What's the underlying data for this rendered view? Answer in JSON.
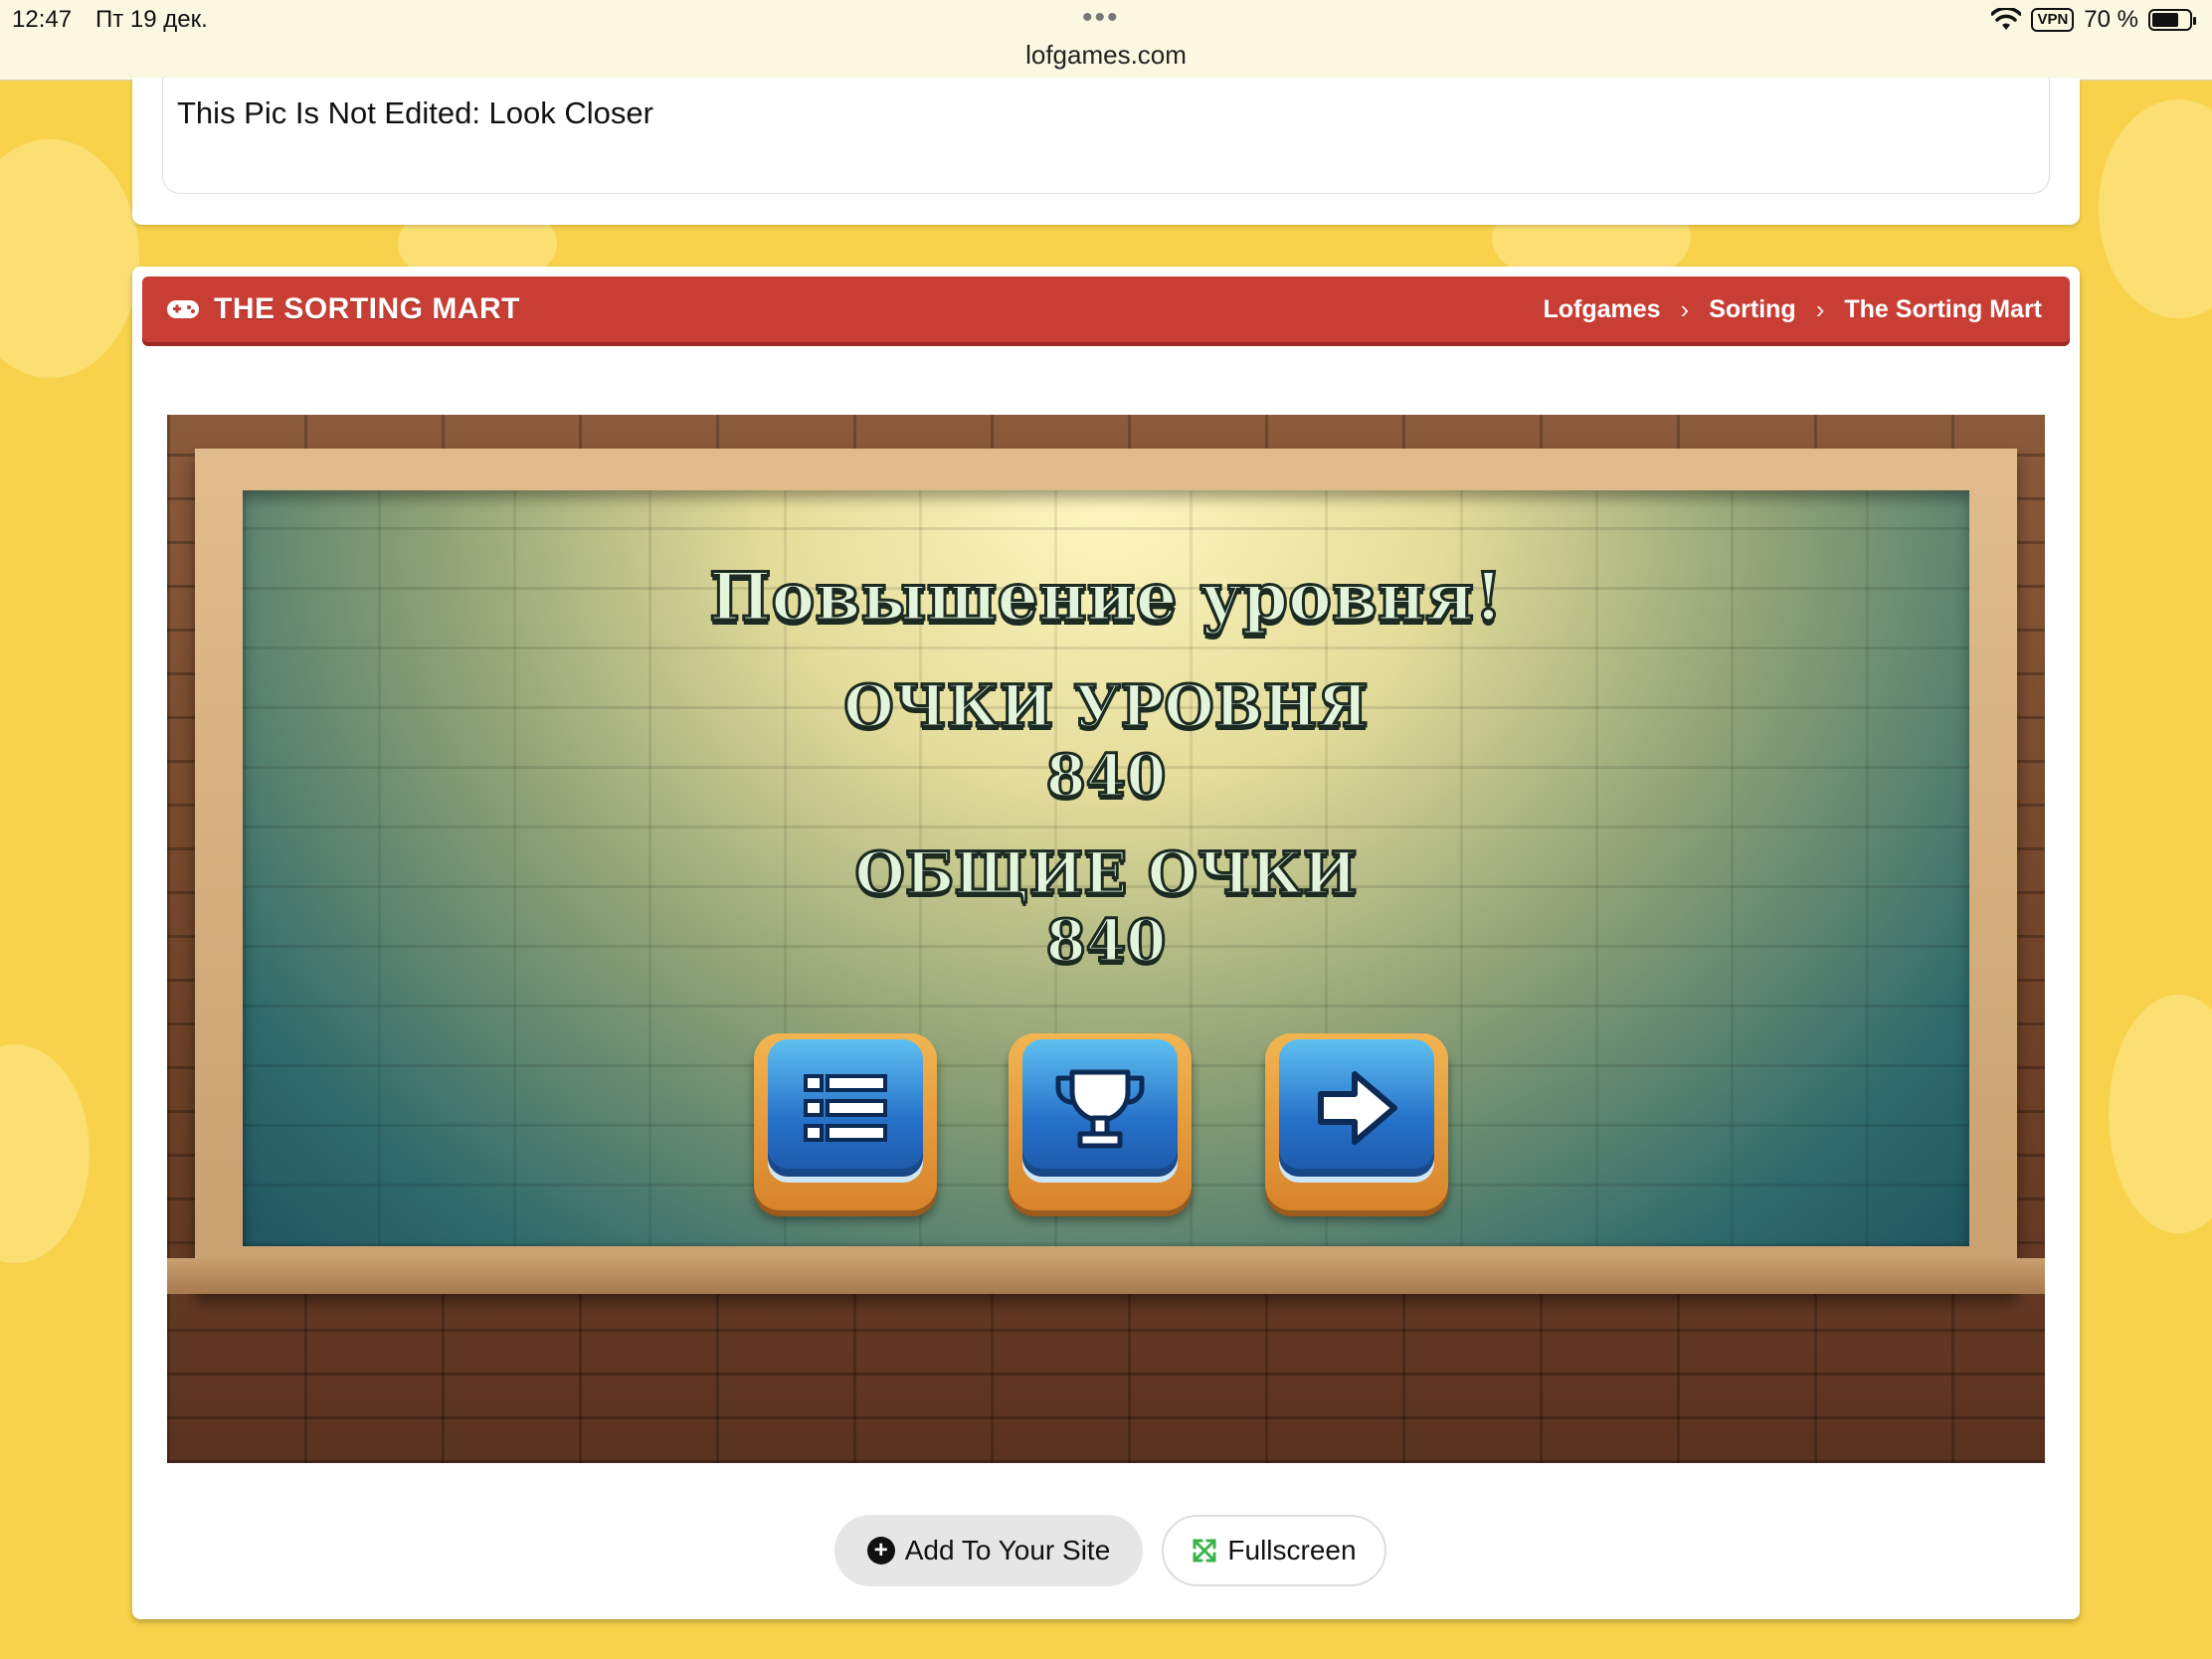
{
  "status_bar": {
    "time": "12:47",
    "date": "Пт 19 дек.",
    "vpn": "VPN",
    "battery": "70 %"
  },
  "browser": {
    "url": "lofgames.com"
  },
  "top_card": {
    "text": "This Pic Is Not Edited: Look Closer"
  },
  "game_card": {
    "title": "THE SORTING MART",
    "breadcrumbs": [
      "Lofgames",
      "Sorting",
      "The Sorting Mart"
    ]
  },
  "game": {
    "heading": "Повышение уровня!",
    "level_score_label": "ОЧКИ УРОВНЯ",
    "level_score": "840",
    "total_score_label": "ОБЩИЕ ОЧКИ",
    "total_score": "840",
    "buttons": [
      {
        "icon": "menu-list-icon"
      },
      {
        "icon": "trophy-icon"
      },
      {
        "icon": "next-arrow-icon"
      }
    ]
  },
  "actions": {
    "add_to_site": "Add To Your Site",
    "fullscreen": "Fullscreen"
  },
  "colors": {
    "background": "#f7d24a",
    "header_bar": "#c93e34",
    "fullscreen_icon": "#3bb34a"
  }
}
